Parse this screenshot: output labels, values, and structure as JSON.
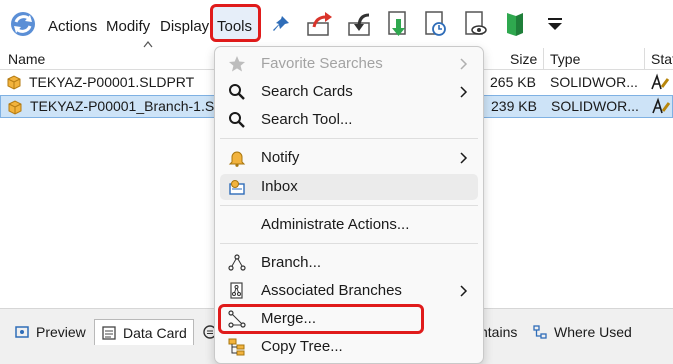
{
  "toolbar": {
    "menus": {
      "actions": "Actions",
      "modify": "Modify",
      "display": "Display",
      "tools": "Tools"
    },
    "icons": [
      "refresh-icon",
      "pin-icon",
      "check-out-icon",
      "check-in-icon",
      "get-latest-icon",
      "get-version-icon",
      "preview-icon",
      "explorer-icon",
      "overflow-icon"
    ]
  },
  "list": {
    "columns": {
      "name": "Name",
      "size": "Size",
      "type": "Type",
      "state": "Stat"
    },
    "rows": [
      {
        "name": "TEKYAZ-P00001.SLDPRT",
        "size": "265 KB",
        "type": "SOLIDWOR...",
        "selected": false
      },
      {
        "name": "TEKYAZ-P00001_Branch-1.Sl",
        "size": "239 KB",
        "type": "SOLIDWOR...",
        "selected": true
      }
    ]
  },
  "menu": {
    "items": [
      {
        "label": "Favorite Searches",
        "icon": "star-icon",
        "disabled": true,
        "submenu": true
      },
      {
        "label": "Search Cards",
        "icon": "search-icon",
        "disabled": false,
        "submenu": true
      },
      {
        "label": "Search Tool...",
        "icon": "search-icon",
        "disabled": false,
        "submenu": false
      },
      {
        "label": "Notify",
        "icon": "bell-icon",
        "disabled": false,
        "submenu": true
      },
      {
        "label": "Inbox",
        "icon": "inbox-icon",
        "disabled": false,
        "submenu": false
      },
      {
        "label": "Administrate Actions...",
        "icon": "",
        "disabled": false,
        "submenu": false
      },
      {
        "label": "Branch...",
        "icon": "branch-icon",
        "disabled": false,
        "submenu": false
      },
      {
        "label": "Associated Branches",
        "icon": "associated-branches-icon",
        "disabled": false,
        "submenu": true
      },
      {
        "label": "Merge...",
        "icon": "merge-icon",
        "disabled": false,
        "submenu": false
      },
      {
        "label": "Copy Tree...",
        "icon": "copy-tree-icon",
        "disabled": false,
        "submenu": false
      }
    ]
  },
  "bottom_tabs": {
    "preview": "Preview",
    "data_card": "Data Card",
    "contains": "ntains",
    "where_used": "Where Used"
  },
  "colors": {
    "highlight_red": "#e01b1b",
    "selection_blue": "#cde3f7",
    "accent_green": "#2fa84f"
  }
}
